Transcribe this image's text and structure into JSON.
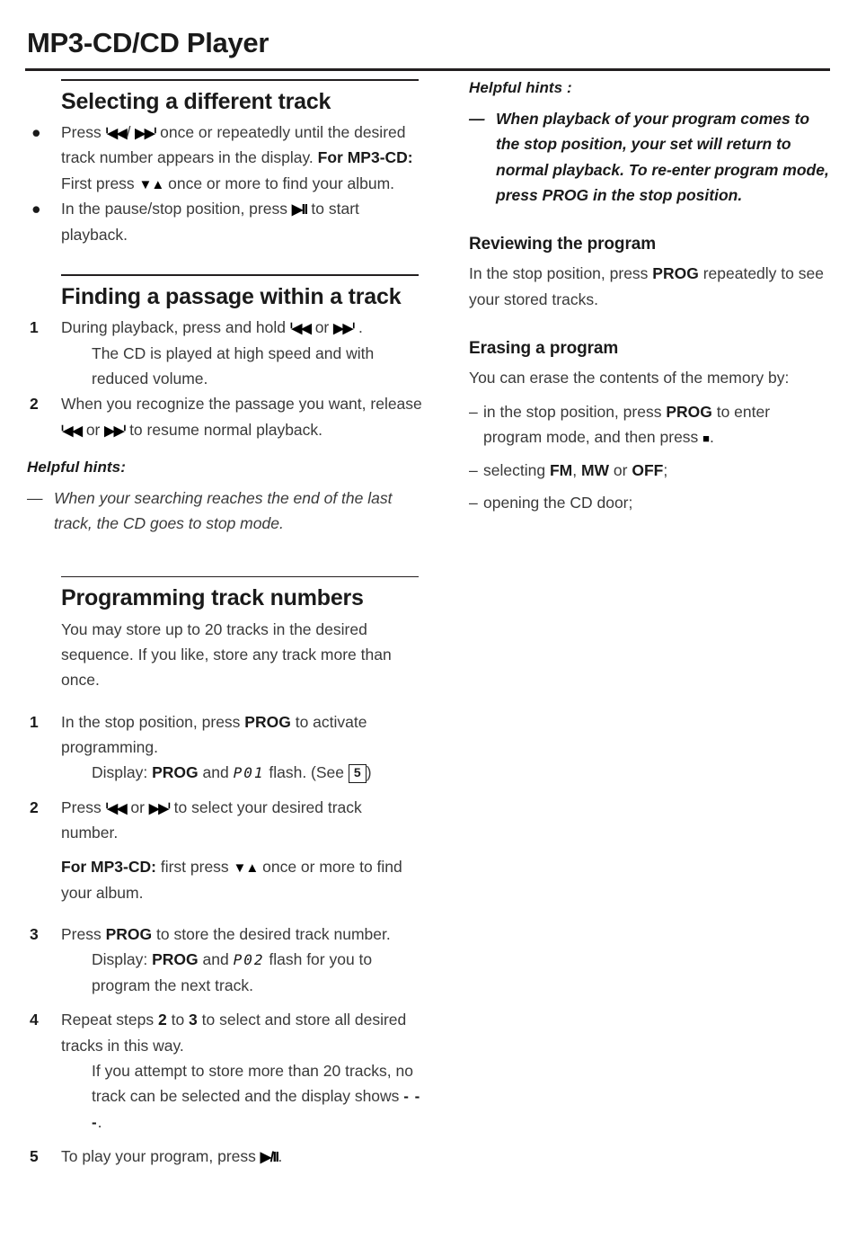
{
  "header": {
    "title": "MP3-CD/CD Player"
  },
  "symbols": {
    "prev": "ᑊ◀◀",
    "next": "▶▶ᑊ",
    "play_pause": "▶II",
    "play_pause_alt": "▶/II",
    "down_up": "▼▲",
    "stop": "■",
    "bullet": "●",
    "dash": "–",
    "em_dash": "—"
  },
  "left_column": {
    "sections": [
      {
        "id": "selecting-track",
        "heading": "Selecting a different track",
        "bullets": [
          {
            "line1_a": "Press ",
            "line1_b": " once or repeatedly until the desired track number appears in the display. ",
            "bold1": "For MP3-CD:",
            "line1_c": " First press ",
            "line1_d": " once or more to find your album."
          },
          {
            "text_a": "In the pause/stop position, press ",
            "text_b": " to start playback."
          }
        ]
      },
      {
        "id": "finding-passage",
        "heading": "Finding a passage within a track",
        "steps": [
          {
            "num": "1",
            "text_a": "During playback, press and hold ",
            "text_b": " or ",
            "text_c": " .",
            "sub": "The CD is played at high speed and with reduced volume."
          },
          {
            "num": "2",
            "text_a": "When you recognize the passage you want, release ",
            "text_b": " or ",
            "text_c": " to resume normal playback."
          }
        ],
        "hints_heading": "Helpful hints:",
        "hints": [
          "When your searching reaches the end of the last track, the CD goes to stop mode."
        ]
      },
      {
        "id": "programming-track-numbers",
        "heading": "Programming track numbers",
        "intro": "You may store up to 20 tracks in the desired sequence. If you like, store any track more than once.",
        "steps": [
          {
            "num": "1",
            "text_a": "In the stop position, press ",
            "bold": "PROG",
            "text_b": " to activate programming.",
            "sub_a": "Display: ",
            "sub_bold": "PROG",
            "sub_b": " and ",
            "sub_lcd": "P01",
            "sub_c": " flash. (See ",
            "sub_ref": "5",
            "sub_d": ")"
          },
          {
            "num": "2",
            "text_a": "Press ",
            "text_b": " or ",
            "text_c": " to select your desired track number.",
            "extra_bold": "For MP3-CD:",
            "extra_a": " first press ",
            "extra_b": " once or more to find your album."
          },
          {
            "num": "3",
            "text_a": "Press ",
            "bold": "PROG",
            "text_b": " to store the desired track number.",
            "sub_a": "Display: ",
            "sub_bold": "PROG",
            "sub_b": " and ",
            "sub_lcd": "P02",
            "sub_c": " flash for you to program the next track."
          },
          {
            "num": "4",
            "text_a": "Repeat steps ",
            "bold_a": "2",
            "text_b": " to ",
            "bold_b": "3",
            "text_c": " to select and store all desired tracks in this way.",
            "sub_a": "If you attempt to store more than 20 tracks, no track can be selected and the display shows ",
            "sub_dashes": "- - -",
            "sub_b": "."
          },
          {
            "num": "5",
            "text_a": "To play your program, press ",
            "text_b": "."
          }
        ]
      }
    ]
  },
  "right_column": {
    "hints_heading": "Helpful hints :",
    "hints": [
      "When playback of your program comes to the stop position, your set will return to normal playback. To re-enter program mode, press PROG in the stop position."
    ],
    "sections": [
      {
        "id": "reviewing-the-program",
        "heading": "Reviewing the program",
        "text_a": "In the stop position, press ",
        "bold": "PROG",
        "text_b": " repeatedly to see your stored tracks."
      },
      {
        "id": "erasing-a-program",
        "heading": "Erasing a program",
        "intro": "You can erase the contents of the memory by:",
        "items": [
          {
            "text_a": "in the stop position, press ",
            "bold": "PROG",
            "text_b": " to enter program mode, and then press ",
            "text_c": "."
          },
          {
            "text_a": "selecting ",
            "bold_a": "FM",
            "text_b": ", ",
            "bold_b": "MW",
            "text_c": " or ",
            "bold_c": "OFF",
            "text_d": ";"
          },
          {
            "text_a": "opening the CD door;"
          }
        ]
      }
    ]
  }
}
